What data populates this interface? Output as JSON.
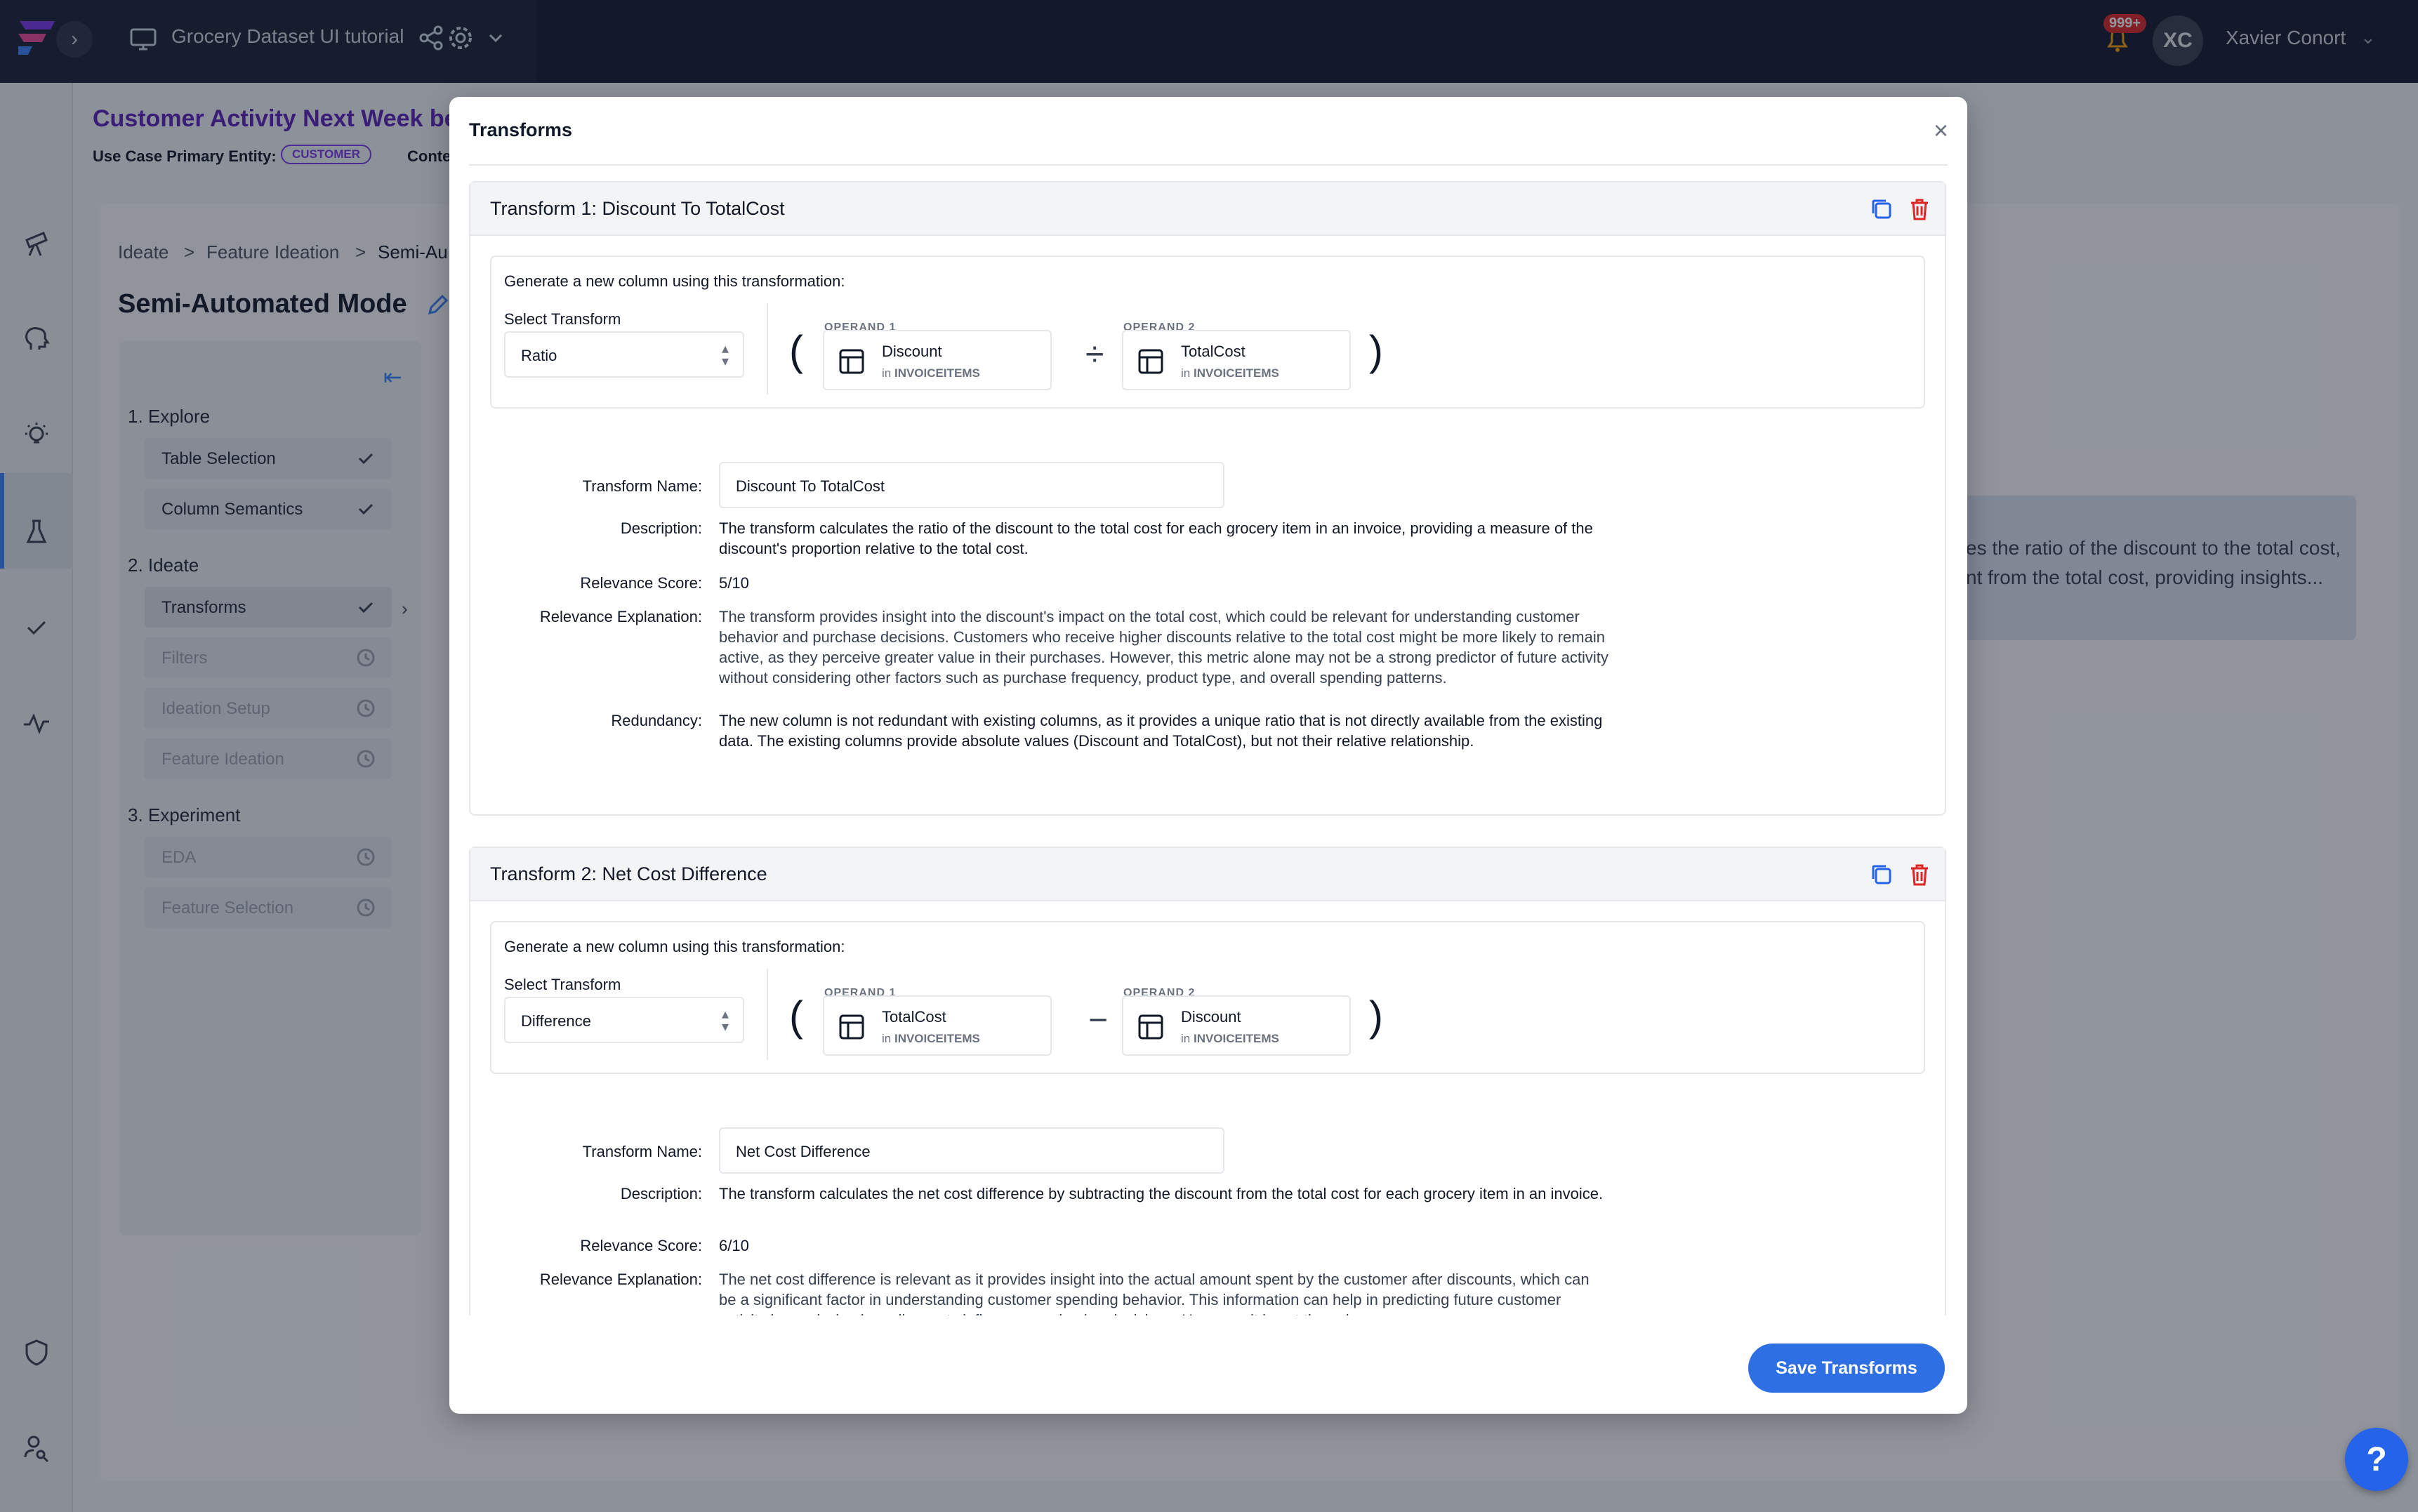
{
  "topbar": {
    "project_title": "Grocery Dataset UI tutorial",
    "notification_count": "999+",
    "user_initials": "XC",
    "user_name": "Xavier Conort"
  },
  "page": {
    "title": "Customer Activity Next Week be",
    "entity_label": "Use Case Primary Entity:",
    "entity_badge": "CUSTOMER",
    "context_label": "Conte",
    "breadcrumb": [
      "Ideate",
      ">",
      "Feature Ideation",
      ">",
      "Semi-Au"
    ],
    "mode_title": "Semi-Automated Mode",
    "bg_right_text": [
      "es the ratio of the discount to the total cost,",
      "nt from the total cost, providing insights..."
    ]
  },
  "steps": {
    "explore": {
      "heading": "1. Explore",
      "items": [
        {
          "label": "Table Selection"
        },
        {
          "label": "Column Semantics"
        }
      ]
    },
    "ideate": {
      "heading": "2. Ideate",
      "items": [
        {
          "label": "Transforms"
        },
        {
          "label": "Filters"
        },
        {
          "label": "Ideation Setup"
        },
        {
          "label": "Feature Ideation"
        }
      ]
    },
    "experiment": {
      "heading": "3. Experiment",
      "items": [
        {
          "label": "EDA"
        },
        {
          "label": "Feature Selection"
        }
      ]
    }
  },
  "modal": {
    "title": "Transforms",
    "close": "×",
    "save_label": "Save Transforms",
    "labels": {
      "generate": "Generate a new column using this transformation:",
      "select_transform": "Select Transform",
      "operand1": "OPERAND 1",
      "operand2": "OPERAND 2",
      "in_prefix": "in",
      "transform_name": "Transform Name:",
      "description": "Description:",
      "relevance_score": "Relevance Score:",
      "relevance_explanation": "Relevance Explanation:",
      "redundancy": "Redundancy:"
    },
    "transforms": [
      {
        "header": "Transform 1: Discount To TotalCost",
        "select_value": "Ratio",
        "operand1": {
          "name": "Discount",
          "table": "INVOICEITEMS"
        },
        "operator": "÷",
        "operand2": {
          "name": "TotalCost",
          "table": "INVOICEITEMS"
        },
        "name": "Discount To TotalCost",
        "description": "The transform calculates the ratio of the discount to the total cost for each grocery item in an invoice, providing a measure of the discount's proportion relative to the total cost.",
        "relevance_score": "5/10",
        "relevance_explanation": "The transform provides insight into the discount's impact on the total cost, which could be relevant for understanding customer behavior and purchase decisions. Customers who receive higher discounts relative to the total cost might be more likely to remain active, as they perceive greater value in their purchases. However, this metric alone may not be a strong predictor of future activity without considering other factors such as purchase frequency, product type, and overall spending patterns.",
        "redundancy": "The new column is not redundant with existing columns, as it provides a unique ratio that is not directly available from the existing data. The existing columns provide absolute values (Discount and TotalCost), but not their relative relationship."
      },
      {
        "header": "Transform 2: Net Cost Difference",
        "select_value": "Difference",
        "operand1": {
          "name": "TotalCost",
          "table": "INVOICEITEMS"
        },
        "operator": "−",
        "operand2": {
          "name": "Discount",
          "table": "INVOICEITEMS"
        },
        "name": "Net Cost Difference",
        "description": "The transform calculates the net cost difference by subtracting the discount from the total cost for each grocery item in an invoice.",
        "relevance_score": "6/10",
        "relevance_explanation": "The net cost difference is relevant as it provides insight into the actual amount spent by the customer after discounts, which can be a significant factor in understanding customer spending behavior. This information can help in predicting future customer activity by analyzing how discounts influence purchasing decisions. However, it is not the sole"
      }
    ]
  },
  "help": {
    "label": "?"
  },
  "colors": {
    "accent": "#2f6fe4",
    "danger": "#dc2626",
    "topbar": "#141b2d",
    "brand_purple": "#5b21b6"
  }
}
